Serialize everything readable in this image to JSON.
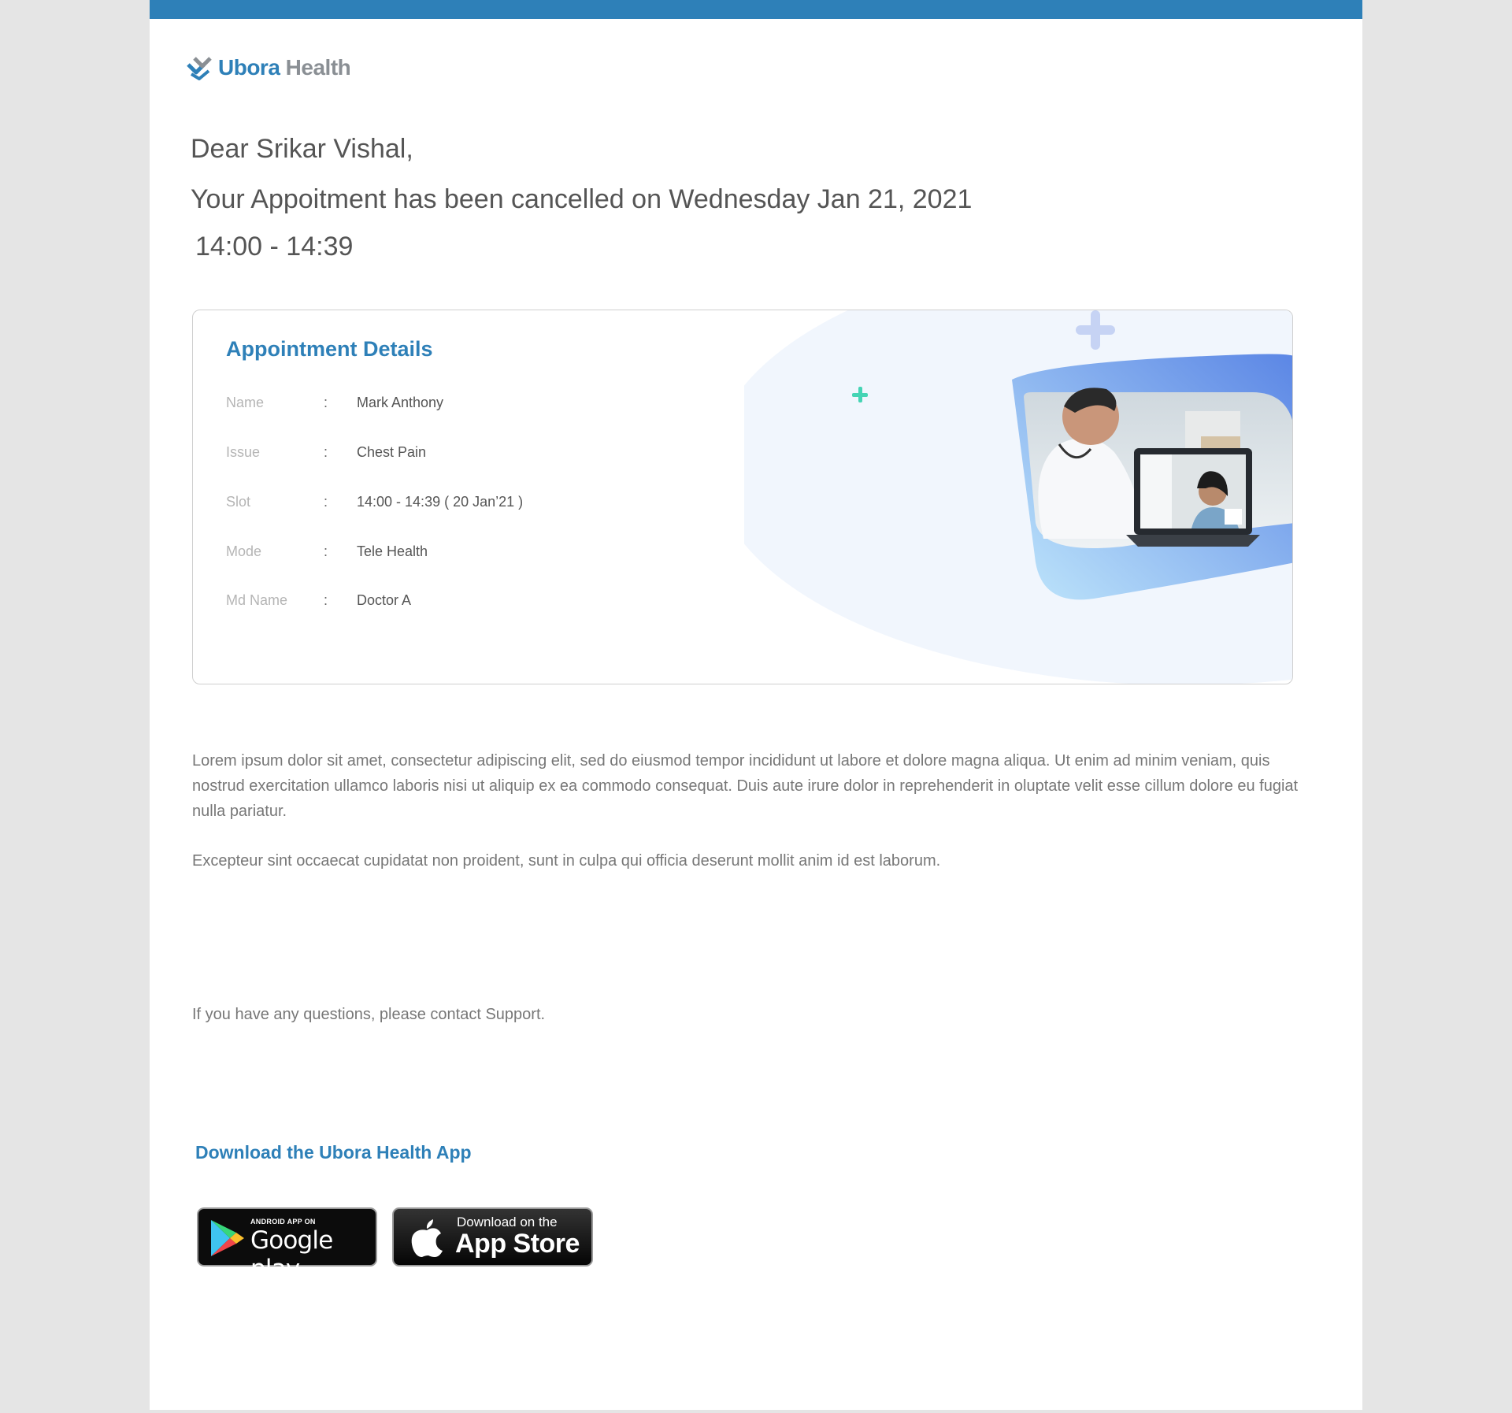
{
  "brand": {
    "name_part1": "Ubora",
    "name_part2": " Health"
  },
  "greeting": {
    "salutation": "Dear Srikar Vishal,",
    "message": "Your Appoitment has been cancelled on Wednesday Jan 21, 2021",
    "time": "14:00 - 14:39"
  },
  "details": {
    "title": "Appointment Details",
    "separator": ":",
    "rows": [
      {
        "label": "Name",
        "value": "Mark Anthony"
      },
      {
        "label": "Issue",
        "value": "Chest Pain"
      },
      {
        "label": "Slot",
        "value": "14:00 - 14:39 ( 20 Jan’21 )"
      },
      {
        "label": "Mode",
        "value": "Tele Health"
      },
      {
        "label": "Md Name",
        "value": "Doctor A"
      }
    ]
  },
  "body": {
    "paragraph1": "Lorem ipsum dolor sit amet, consectetur adipiscing elit, sed do eiusmod tempor incididunt ut labore et dolore magna aliqua. Ut enim ad minim veniam, quis nostrud exercitation ullamco laboris nisi ut aliquip ex ea commodo consequat. Duis aute irure dolor in reprehenderit in oluptate velit esse cillum dolore eu fugiat nulla pariatur.",
    "paragraph2": "Excepteur sint occaecat cupidatat non proident, sunt in culpa qui officia deserunt mollit anim id est laborum.",
    "support": "If you have any questions, please contact Support."
  },
  "download": {
    "title": "Download the Ubora Health App",
    "google_play": {
      "small": "ANDROID APP ON",
      "big": "Google play"
    },
    "app_store": {
      "small": "Download on the",
      "big": "App Store"
    }
  },
  "colors": {
    "accent": "#2e80b8",
    "topbar": "#2e80b8",
    "page_bg": "#e5e5e5"
  }
}
